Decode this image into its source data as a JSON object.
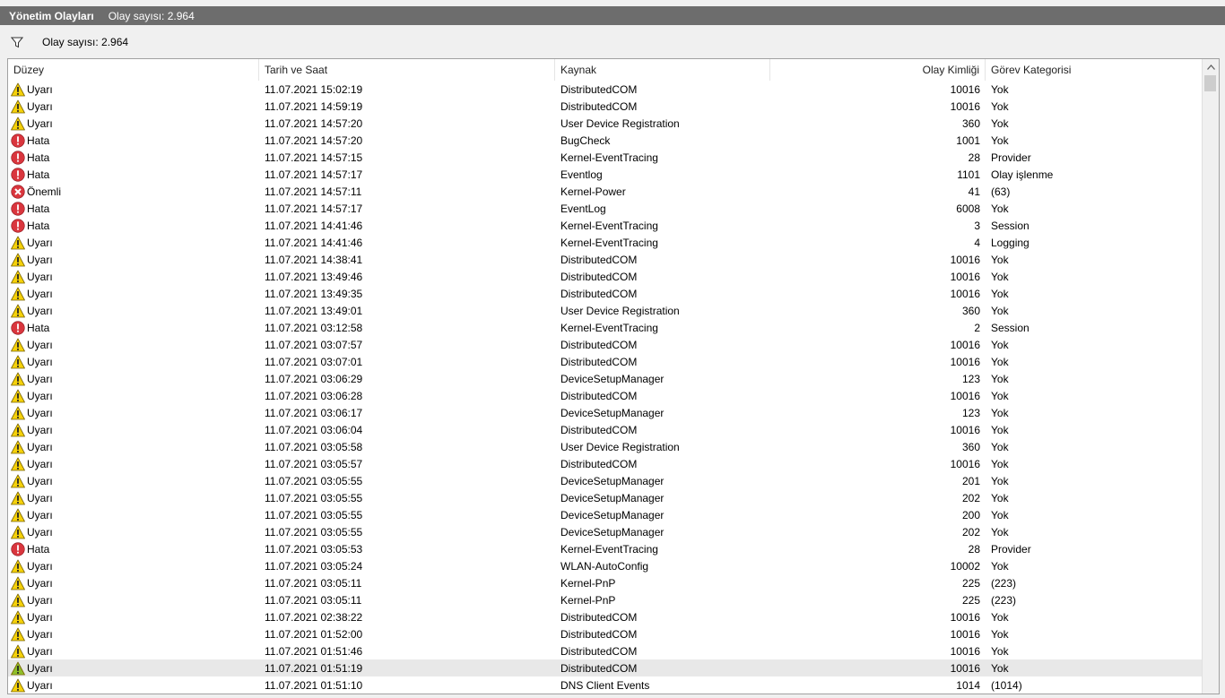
{
  "window": {
    "title": "Yönetim Olayları",
    "count": "Olay sayısı: 2.964"
  },
  "filter": {
    "text": "Olay sayısı: 2.964",
    "icon": "filter-icon"
  },
  "columns": [
    "Düzey",
    "Tarih ve Saat",
    "Kaynak",
    "Olay Kimliği",
    "Görev Kategorisi"
  ],
  "colors": {
    "warning": "#f5d10a",
    "error": "#d9363e",
    "critical": "#d9363e",
    "titlebar": "#6d6d6d"
  },
  "rows": [
    {
      "level": "Uyarı",
      "type": "warning",
      "date": "11.07.2021 15:02:19",
      "source": "DistributedCOM",
      "id": "10016",
      "task": "Yok"
    },
    {
      "level": "Uyarı",
      "type": "warning",
      "date": "11.07.2021 14:59:19",
      "source": "DistributedCOM",
      "id": "10016",
      "task": "Yok"
    },
    {
      "level": "Uyarı",
      "type": "warning",
      "date": "11.07.2021 14:57:20",
      "source": "User Device Registration",
      "id": "360",
      "task": "Yok"
    },
    {
      "level": "Hata",
      "type": "error",
      "date": "11.07.2021 14:57:20",
      "source": "BugCheck",
      "id": "1001",
      "task": "Yok"
    },
    {
      "level": "Hata",
      "type": "error",
      "date": "11.07.2021 14:57:15",
      "source": "Kernel-EventTracing",
      "id": "28",
      "task": "Provider"
    },
    {
      "level": "Hata",
      "type": "error",
      "date": "11.07.2021 14:57:17",
      "source": "Eventlog",
      "id": "1101",
      "task": "Olay işlenme"
    },
    {
      "level": "Önemli",
      "type": "critical",
      "date": "11.07.2021 14:57:11",
      "source": "Kernel-Power",
      "id": "41",
      "task": "(63)"
    },
    {
      "level": "Hata",
      "type": "error",
      "date": "11.07.2021 14:57:17",
      "source": "EventLog",
      "id": "6008",
      "task": "Yok"
    },
    {
      "level": "Hata",
      "type": "error",
      "date": "11.07.2021 14:41:46",
      "source": "Kernel-EventTracing",
      "id": "3",
      "task": "Session"
    },
    {
      "level": "Uyarı",
      "type": "warning",
      "date": "11.07.2021 14:41:46",
      "source": "Kernel-EventTracing",
      "id": "4",
      "task": "Logging"
    },
    {
      "level": "Uyarı",
      "type": "warning",
      "date": "11.07.2021 14:38:41",
      "source": "DistributedCOM",
      "id": "10016",
      "task": "Yok"
    },
    {
      "level": "Uyarı",
      "type": "warning",
      "date": "11.07.2021 13:49:46",
      "source": "DistributedCOM",
      "id": "10016",
      "task": "Yok"
    },
    {
      "level": "Uyarı",
      "type": "warning",
      "date": "11.07.2021 13:49:35",
      "source": "DistributedCOM",
      "id": "10016",
      "task": "Yok"
    },
    {
      "level": "Uyarı",
      "type": "warning",
      "date": "11.07.2021 13:49:01",
      "source": "User Device Registration",
      "id": "360",
      "task": "Yok"
    },
    {
      "level": "Hata",
      "type": "error",
      "date": "11.07.2021 03:12:58",
      "source": "Kernel-EventTracing",
      "id": "2",
      "task": "Session"
    },
    {
      "level": "Uyarı",
      "type": "warning",
      "date": "11.07.2021 03:07:57",
      "source": "DistributedCOM",
      "id": "10016",
      "task": "Yok"
    },
    {
      "level": "Uyarı",
      "type": "warning",
      "date": "11.07.2021 03:07:01",
      "source": "DistributedCOM",
      "id": "10016",
      "task": "Yok"
    },
    {
      "level": "Uyarı",
      "type": "warning",
      "date": "11.07.2021 03:06:29",
      "source": "DeviceSetupManager",
      "id": "123",
      "task": "Yok"
    },
    {
      "level": "Uyarı",
      "type": "warning",
      "date": "11.07.2021 03:06:28",
      "source": "DistributedCOM",
      "id": "10016",
      "task": "Yok"
    },
    {
      "level": "Uyarı",
      "type": "warning",
      "date": "11.07.2021 03:06:17",
      "source": "DeviceSetupManager",
      "id": "123",
      "task": "Yok"
    },
    {
      "level": "Uyarı",
      "type": "warning",
      "date": "11.07.2021 03:06:04",
      "source": "DistributedCOM",
      "id": "10016",
      "task": "Yok"
    },
    {
      "level": "Uyarı",
      "type": "warning",
      "date": "11.07.2021 03:05:58",
      "source": "User Device Registration",
      "id": "360",
      "task": "Yok"
    },
    {
      "level": "Uyarı",
      "type": "warning",
      "date": "11.07.2021 03:05:57",
      "source": "DistributedCOM",
      "id": "10016",
      "task": "Yok"
    },
    {
      "level": "Uyarı",
      "type": "warning",
      "date": "11.07.2021 03:05:55",
      "source": "DeviceSetupManager",
      "id": "201",
      "task": "Yok"
    },
    {
      "level": "Uyarı",
      "type": "warning",
      "date": "11.07.2021 03:05:55",
      "source": "DeviceSetupManager",
      "id": "202",
      "task": "Yok"
    },
    {
      "level": "Uyarı",
      "type": "warning",
      "date": "11.07.2021 03:05:55",
      "source": "DeviceSetupManager",
      "id": "200",
      "task": "Yok"
    },
    {
      "level": "Uyarı",
      "type": "warning",
      "date": "11.07.2021 03:05:55",
      "source": "DeviceSetupManager",
      "id": "202",
      "task": "Yok"
    },
    {
      "level": "Hata",
      "type": "error",
      "date": "11.07.2021 03:05:53",
      "source": "Kernel-EventTracing",
      "id": "28",
      "task": "Provider"
    },
    {
      "level": "Uyarı",
      "type": "warning",
      "date": "11.07.2021 03:05:24",
      "source": "WLAN-AutoConfig",
      "id": "10002",
      "task": "Yok"
    },
    {
      "level": "Uyarı",
      "type": "warning",
      "date": "11.07.2021 03:05:11",
      "source": "Kernel-PnP",
      "id": "225",
      "task": "(223)"
    },
    {
      "level": "Uyarı",
      "type": "warning",
      "date": "11.07.2021 03:05:11",
      "source": "Kernel-PnP",
      "id": "225",
      "task": "(223)"
    },
    {
      "level": "Uyarı",
      "type": "warning",
      "date": "11.07.2021 02:38:22",
      "source": "DistributedCOM",
      "id": "10016",
      "task": "Yok"
    },
    {
      "level": "Uyarı",
      "type": "warning",
      "date": "11.07.2021 01:52:00",
      "source": "DistributedCOM",
      "id": "10016",
      "task": "Yok"
    },
    {
      "level": "Uyarı",
      "type": "warning",
      "date": "11.07.2021 01:51:46",
      "source": "DistributedCOM",
      "id": "10016",
      "task": "Yok"
    },
    {
      "level": "Uyarı",
      "type": "warning",
      "date": "11.07.2021 01:51:19",
      "source": "DistributedCOM",
      "id": "10016",
      "task": "Yok",
      "selected": true
    },
    {
      "level": "Uyarı",
      "type": "warning",
      "date": "11.07.2021 01:51:10",
      "source": "DNS Client Events",
      "id": "1014",
      "task": "(1014)"
    }
  ]
}
